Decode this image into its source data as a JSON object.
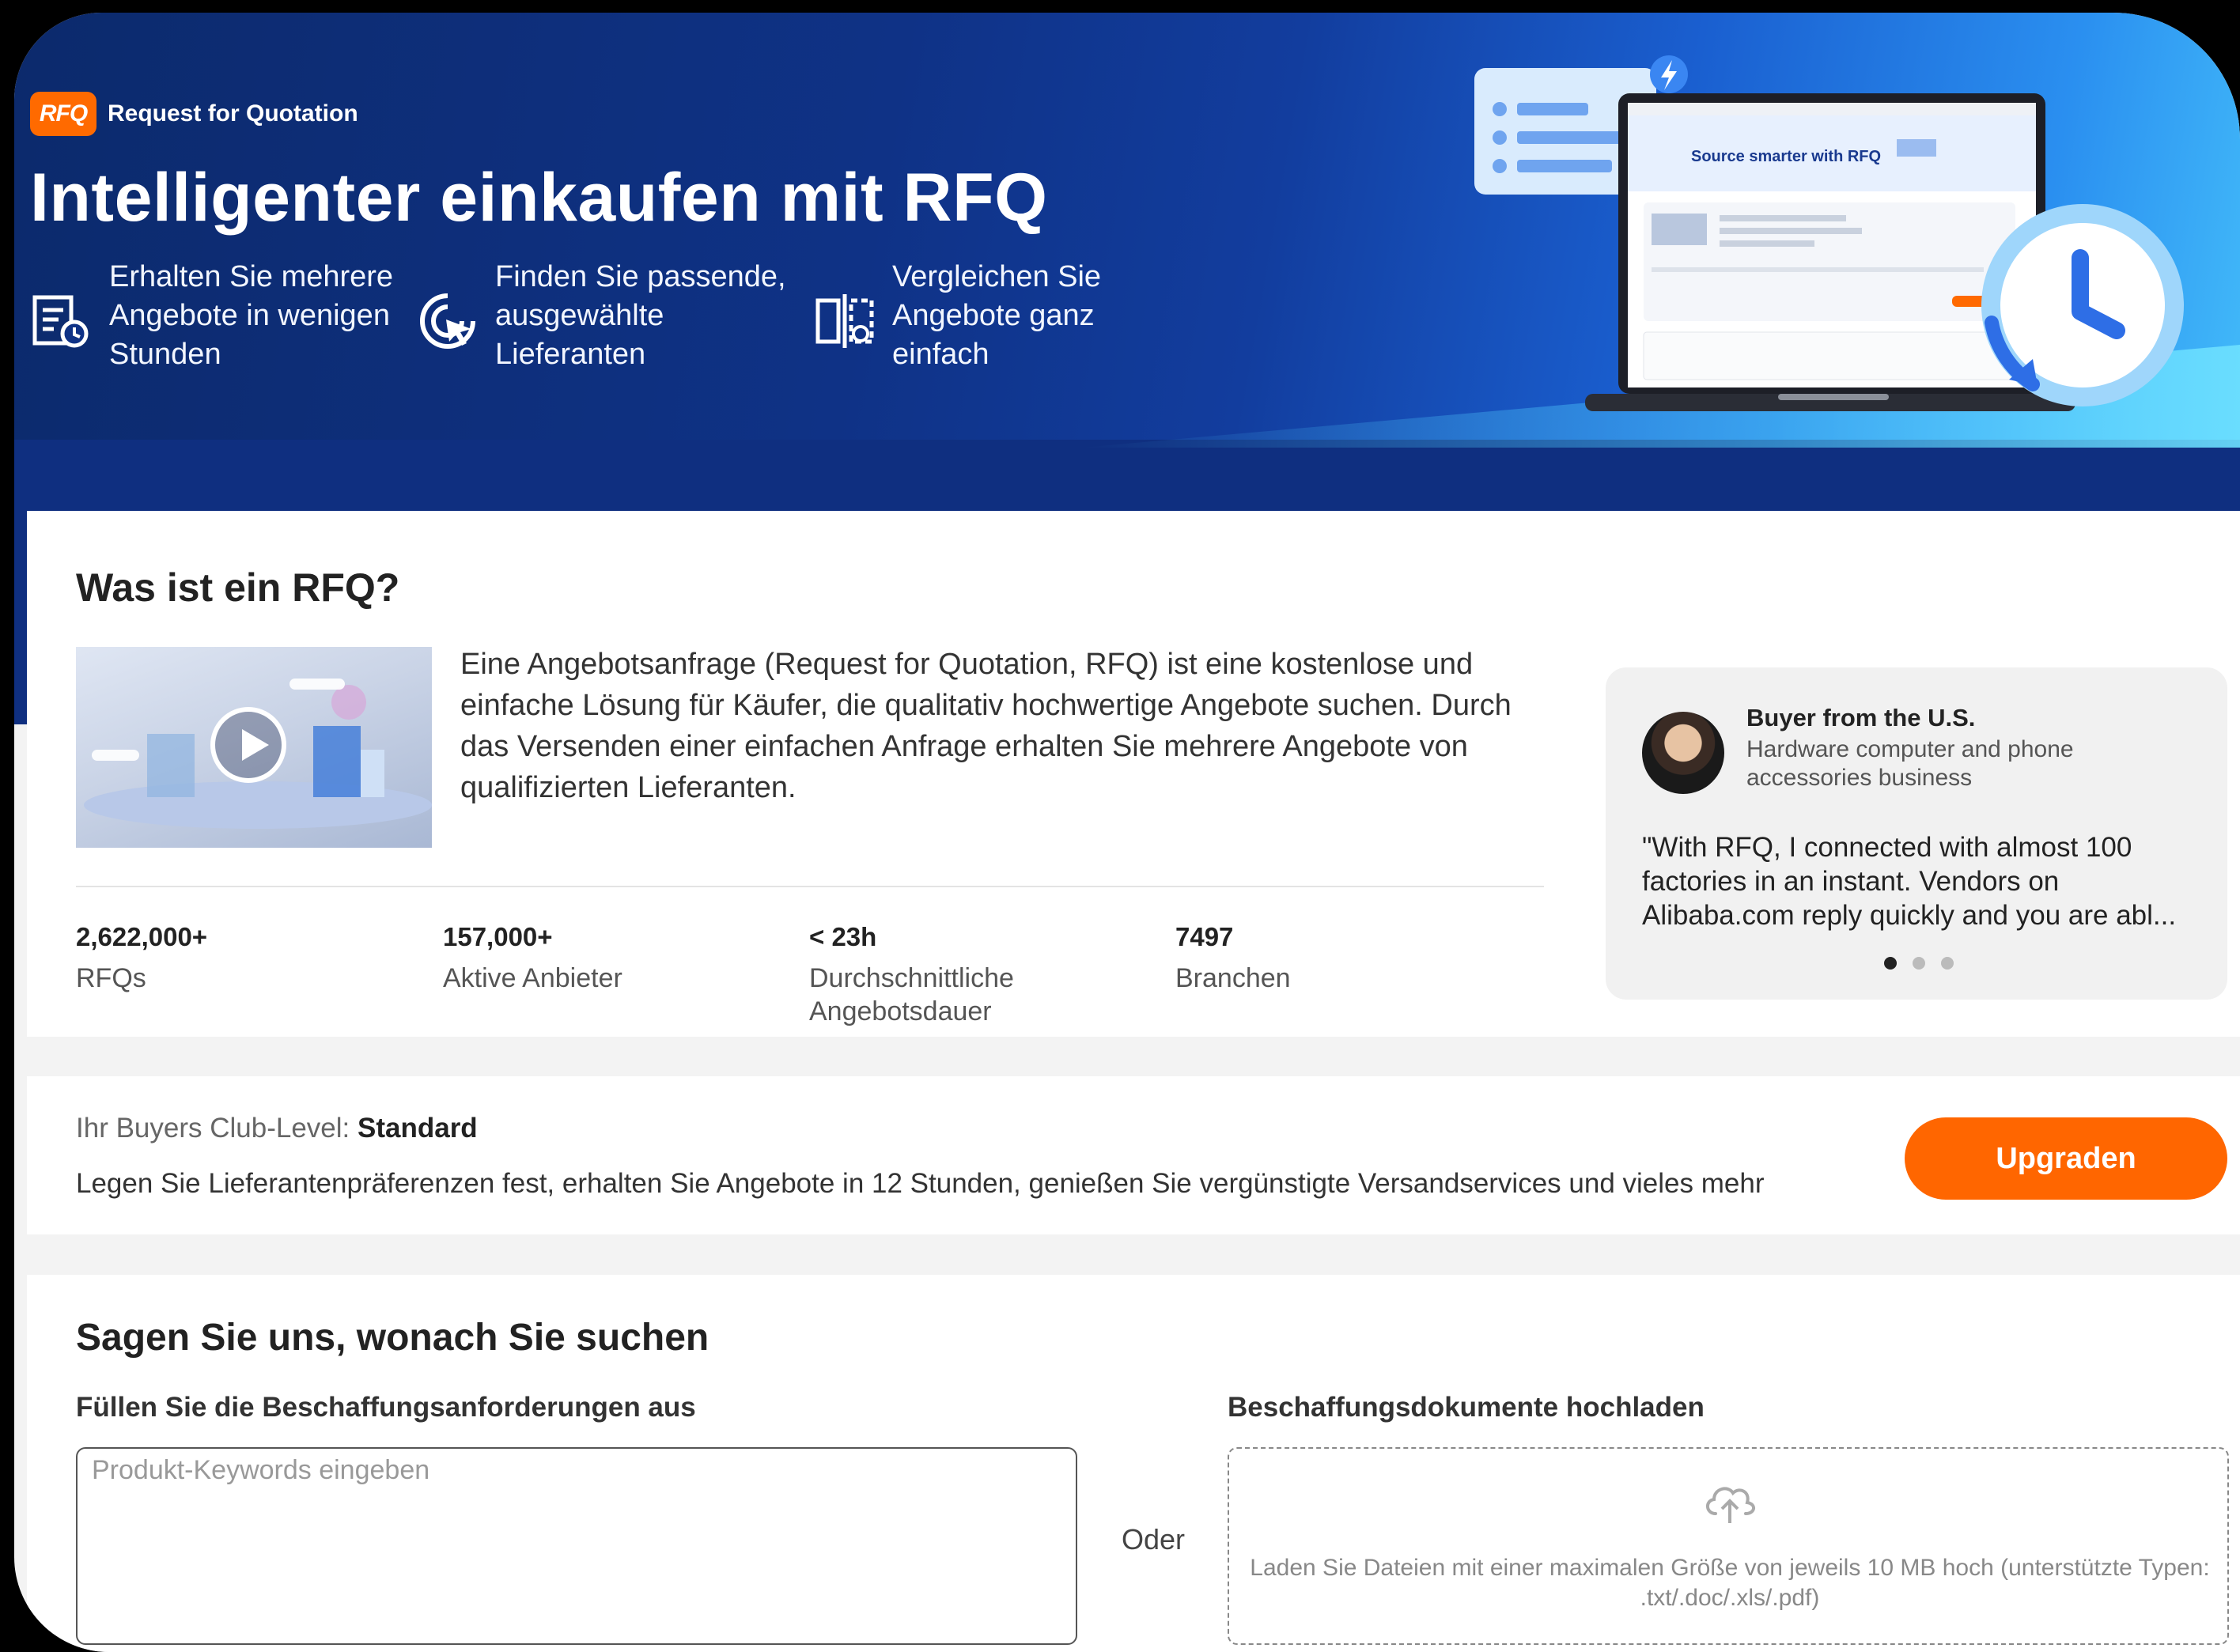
{
  "hero": {
    "brand_logo": "RFQ",
    "brand_name": "Request for Quotation",
    "title": "Intelligenter einkaufen mit RFQ",
    "features": [
      {
        "icon": "document-quote-icon",
        "text": "Erhalten Sie mehrere Angebote in wenigen Stunden"
      },
      {
        "icon": "target-cursor-icon",
        "text": "Finden Sie passende, ausgewählte Lieferanten"
      },
      {
        "icon": "compare-icon",
        "text": "Vergleichen Sie Angebote ganz einfach"
      }
    ],
    "illustration": {
      "screen_headline": "Source smarter with RFQ",
      "icons": [
        "laptop-icon",
        "clock-icon",
        "lightning-icon"
      ]
    }
  },
  "what_is": {
    "title": "Was ist ein RFQ?",
    "video_icon": "play-icon",
    "description": "Eine Angebotsanfrage (Request for Quotation, RFQ) ist eine kostenlose und einfache Lösung für Käufer, die qualitativ hochwertige Angebote suchen. Durch das Versenden einer einfachen Anfrage erhalten Sie mehrere Angebote von qualifizierten Lieferanten.",
    "stats": [
      {
        "value": "2,622,000+",
        "label": "RFQs"
      },
      {
        "value": "157,000+",
        "label": "Aktive Anbieter"
      },
      {
        "value": "< 23h",
        "label": "Durchschnittliche Angebotsdauer"
      },
      {
        "value": "7497",
        "label": "Branchen"
      }
    ],
    "testimonial": {
      "buyer": "Buyer from the U.S.",
      "business": "Hardware computer and phone accessories business",
      "quote": "\"With RFQ, I connected with almost 100 factories in an instant. Vendors on Alibaba.com reply quickly and you are abl...",
      "dots": 3,
      "active_dot": 0
    }
  },
  "buyers_club": {
    "level_label": "Ihr Buyers Club-Level:",
    "level_value": "Standard",
    "description": "Legen Sie Lieferantenpräferenzen fest, erhalten Sie Angebote in 12 Stunden, genießen Sie vergünstigte Versandservices und vieles mehr",
    "upgrade_label": "Upgraden",
    "accent_color": "#ff6600"
  },
  "tell_us": {
    "title": "Sagen Sie uns, wonach Sie suchen",
    "fill_label": "Füllen Sie die Beschaffungsanforderungen aus",
    "keyword_placeholder": "Produkt-Keywords eingeben",
    "keyword_value": "",
    "or_label": "Oder",
    "upload_label": "Beschaffungsdokumente hochladen",
    "upload_icon": "cloud-upload-icon",
    "upload_hint": "Laden Sie Dateien mit einer maximalen Größe von jeweils 10 MB hoch (unterstützte Typen: .txt/.doc/.xls/.pdf)"
  }
}
